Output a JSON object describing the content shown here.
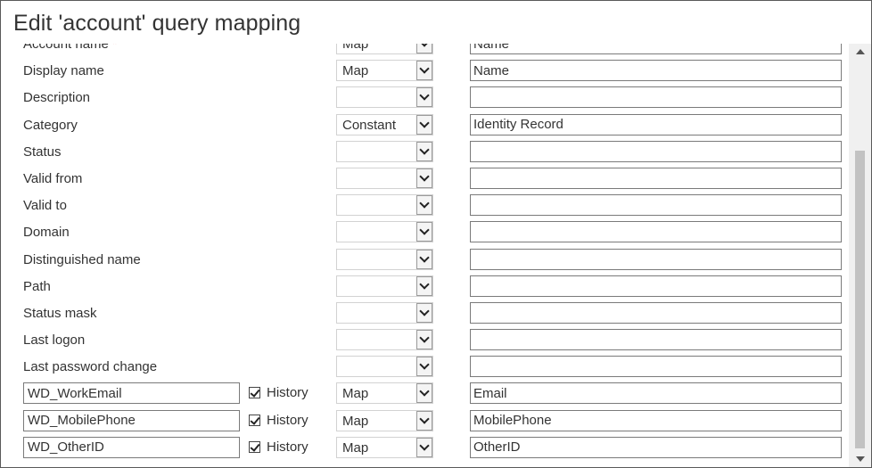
{
  "dialog": {
    "title": "Edit 'account' query mapping"
  },
  "history_label": "History",
  "required_marker": "*",
  "rows": [
    {
      "label": "Account name",
      "required": true,
      "mapping": "Map",
      "value": "Name"
    },
    {
      "label": "Display name",
      "mapping": "Map",
      "value": "Name"
    },
    {
      "label": "Description",
      "mapping": "",
      "value": ""
    },
    {
      "label": "Category",
      "mapping": "Constant",
      "value": "Identity Record"
    },
    {
      "label": "Status",
      "mapping": "",
      "value": ""
    },
    {
      "label": "Valid from",
      "mapping": "",
      "value": ""
    },
    {
      "label": "Valid to",
      "mapping": "",
      "value": ""
    },
    {
      "label": "Domain",
      "mapping": "",
      "value": ""
    },
    {
      "label": "Distinguished name",
      "mapping": "",
      "value": ""
    },
    {
      "label": "Path",
      "mapping": "",
      "value": ""
    },
    {
      "label": "Status mask",
      "mapping": "",
      "value": ""
    },
    {
      "label": "Last logon",
      "mapping": "",
      "value": ""
    },
    {
      "label": "Last password change",
      "mapping": "",
      "value": ""
    },
    {
      "attribute": "WD_WorkEmail",
      "history": true,
      "mapping": "Map",
      "value": "Email"
    },
    {
      "attribute": "WD_MobilePhone",
      "history": true,
      "mapping": "Map",
      "value": "MobilePhone"
    },
    {
      "attribute": "WD_OtherID",
      "history": true,
      "mapping": "Map",
      "value": "OtherID"
    }
  ],
  "icons": {
    "dropdown": "chevron-down-icon",
    "checkbox": "checkbox-checked-icon",
    "scroll_up": "scroll-up-arrow-icon",
    "scroll_down": "scroll-down-arrow-icon"
  },
  "colors": {
    "required": "#d01010",
    "border": "#7a7a7a",
    "scroll_thumb": "#c2c2c2"
  }
}
